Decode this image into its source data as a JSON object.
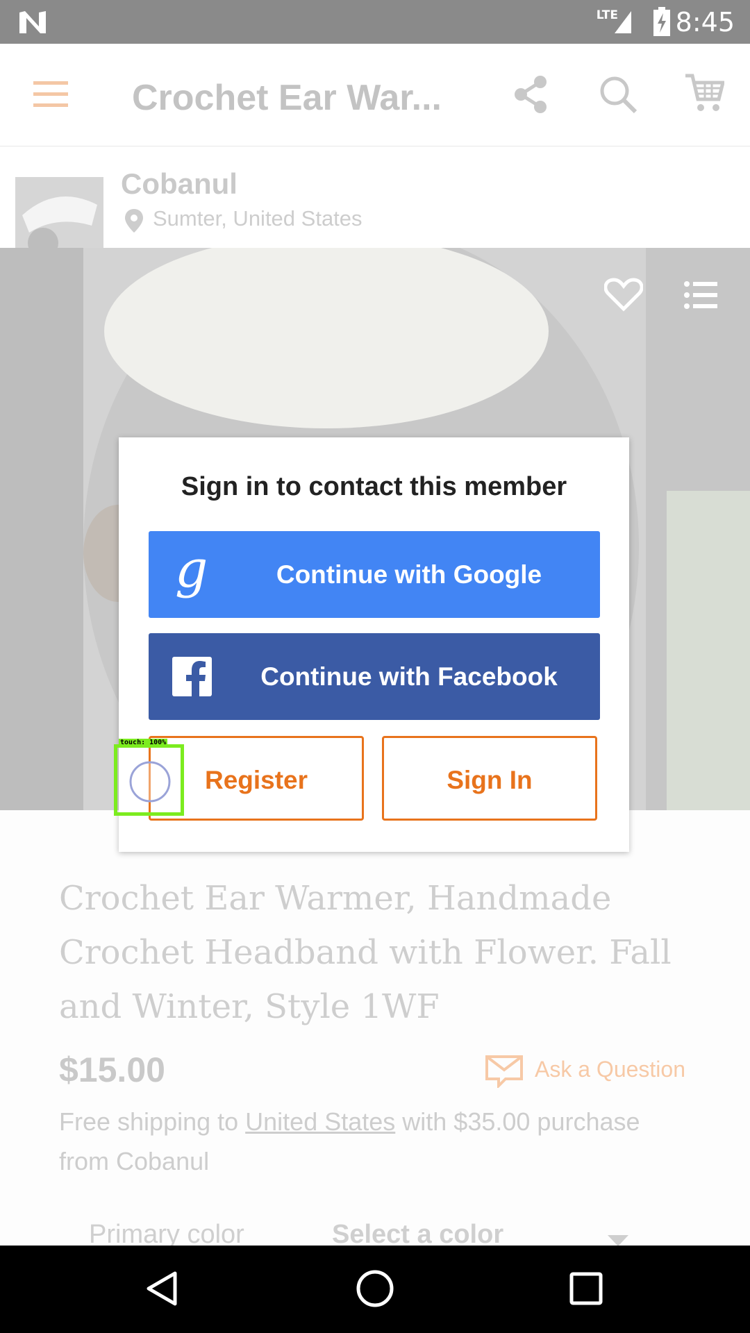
{
  "status_bar": {
    "time": "8:45",
    "network": "LTE"
  },
  "app_bar": {
    "title": "Crochet Ear War..."
  },
  "seller": {
    "name": "Cobanul",
    "location": "Sumter, United States"
  },
  "product": {
    "title": "Crochet Ear Warmer, Handmade Crochet Headband with Flower. Fall and Winter, Style 1WF",
    "price": "$15.00",
    "ask_label": "Ask a Question",
    "shipping_prefix": "Free shipping to ",
    "shipping_link": "United States",
    "shipping_suffix": " with $35.00 purchase from Cobanul",
    "primary_color_label": "Primary color",
    "primary_color_value": "Select a color"
  },
  "dialog": {
    "title": "Sign in to contact this member",
    "google_label": "Continue with Google",
    "facebook_label": "Continue with Facebook",
    "register_label": "Register",
    "signin_label": "Sign In"
  },
  "touch_indicator": {
    "label": "touch: 100%"
  },
  "colors": {
    "google_blue": "#4285f4",
    "facebook_blue": "#3b5ba5",
    "accent_orange": "#e8731c",
    "status_bar": "#8a8a8a",
    "touch_green": "#7cec1f"
  }
}
